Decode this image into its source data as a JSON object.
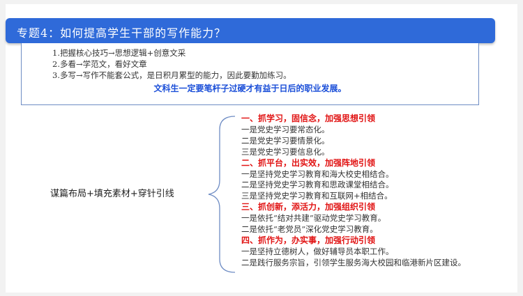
{
  "title": "专题4：如何提高学生干部的写作能力？",
  "intro": {
    "items": [
      "1.把握核心技巧→思想逻辑+创意文采",
      "2.多看→学范文，看好文章",
      "3.多写→写作不能套公式，是日积月累型的能力，因此要勤加练习。"
    ],
    "conclusion": "文科生一定要笔杆子过硬才有益于日后的职业发展。"
  },
  "left_label": "谋篇布局+填充素材+穿针引线",
  "sections": [
    {
      "heading": "一、抓学习，固信念，加强思想引领",
      "items": [
        "一是党史学习要常态化。",
        "二是党史学习要情景化。",
        "三是党史学习要信息化。"
      ]
    },
    {
      "heading": "二、抓平台，出实效，加强阵地引领",
      "items": [
        "一是坚持党史学习教育和海大校史相结合。",
        "二是坚持党史学习教育和思政课堂相结合。",
        "三是坚持党史学习教育和互联网+相结合。"
      ]
    },
    {
      "heading": "三、抓创新，添活力，加强组织引领",
      "items": [
        "一是依托“结对共建”驱动党史学习教育。",
        "二是依托“老党员”深化党史学习教育。"
      ]
    },
    {
      "heading": "四、抓作为，办实事，加强行动引领",
      "items": [
        "一是坚持立德树人，做好辅导员本职工作。",
        "二是践行服务宗旨，引领学生服务海大校园和临港新片区建设。"
      ]
    }
  ],
  "colors": {
    "title_bar": "#2f6ad9",
    "heading_red": "#e11414",
    "conclusion_blue": "#1a4ed8"
  }
}
